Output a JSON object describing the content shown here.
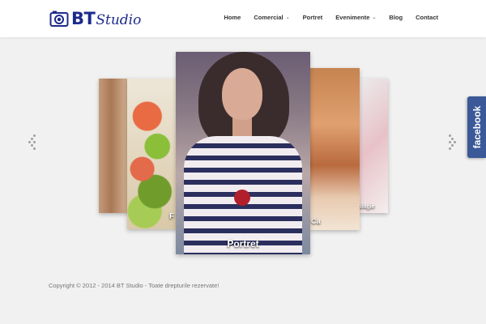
{
  "brand": {
    "name_bold": "BT",
    "name_script": "Studio",
    "color": "#1d2a8c"
  },
  "nav": {
    "items": [
      {
        "label": "Home",
        "has_submenu": false
      },
      {
        "label": "Comercial",
        "has_submenu": true
      },
      {
        "label": "Portret",
        "has_submenu": false
      },
      {
        "label": "Evenimente",
        "has_submenu": true
      },
      {
        "label": "Blog",
        "has_submenu": false
      },
      {
        "label": "Contact",
        "has_submenu": false
      }
    ]
  },
  "slider": {
    "slides": [
      {
        "caption": ""
      },
      {
        "caption": "F"
      },
      {
        "caption": "Portret"
      },
      {
        "caption": "Ca"
      },
      {
        "caption": "ologie"
      }
    ],
    "prev_icon": "dotted-arrow-left-icon",
    "next_icon": "dotted-arrow-right-icon"
  },
  "social": {
    "facebook_label": "facebook",
    "facebook_color": "#3b5998"
  },
  "footer": {
    "copyright": "Copyright © 2012 - 2014 BT Studio - Toate drepturile rezervate!"
  }
}
